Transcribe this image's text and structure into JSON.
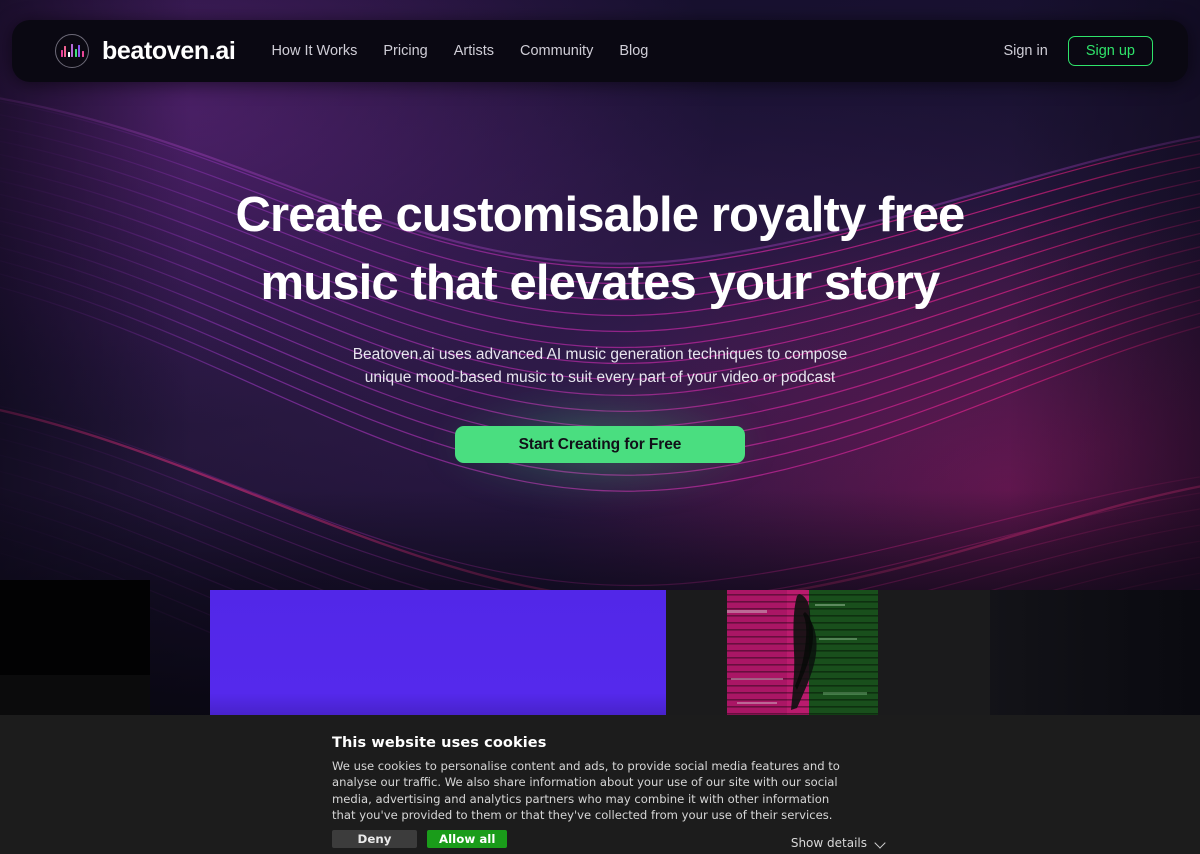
{
  "brand": {
    "name": "beatoven.ai",
    "logo_icon": "audio-bars-circle-icon",
    "logo_bar_colors": [
      "#e8409a",
      "#f06292",
      "#ffffff",
      "#b86bd8",
      "#3fe07a",
      "#8b5cf6",
      "#ec4899"
    ]
  },
  "nav": {
    "links": [
      {
        "label": "How It Works"
      },
      {
        "label": "Pricing"
      },
      {
        "label": "Artists"
      },
      {
        "label": "Community"
      },
      {
        "label": "Blog"
      }
    ],
    "sign_in": "Sign in",
    "sign_up": "Sign up",
    "sign_up_color": "#2fe36a"
  },
  "hero": {
    "headline_line1": "Create customisable royalty free",
    "headline_line2": "music that elevates your story",
    "subheading": "Beatoven.ai uses advanced AI music generation techniques to compose unique mood-based music to suit every part of your video or podcast",
    "cta_label": "Start Creating for Free",
    "cta_color": "#4ade80",
    "background_colors": {
      "base": "#191030",
      "wave_primary": "#7b2f9e",
      "wave_accent": "#d81f7a"
    }
  },
  "media_strip": {
    "tiles": [
      {
        "name": "thumbnail-dark-left",
        "color": "#0b0b0c"
      },
      {
        "name": "thumbnail-purple",
        "color": "#5227e8"
      },
      {
        "name": "thumbnail-glitch-dancer",
        "color": "#1d221b",
        "accent": "#d81f7a"
      },
      {
        "name": "thumbnail-right-edge",
        "color": "#121218"
      }
    ]
  },
  "cookie_banner": {
    "title": "This website uses cookies",
    "body": "We use cookies to personalise content and ads, to provide social media features and to analyse our traffic. We also share information about your use of our site with our social media, advertising and analytics partners who may combine it with other information that you've provided to them or that they've collected from your use of their services.",
    "deny_label": "Deny",
    "allow_label": "Allow all",
    "details_label": "Show details",
    "deny_color": "#3c3c3c",
    "allow_color": "#1a9c1a",
    "background": "#1c1c1c"
  }
}
